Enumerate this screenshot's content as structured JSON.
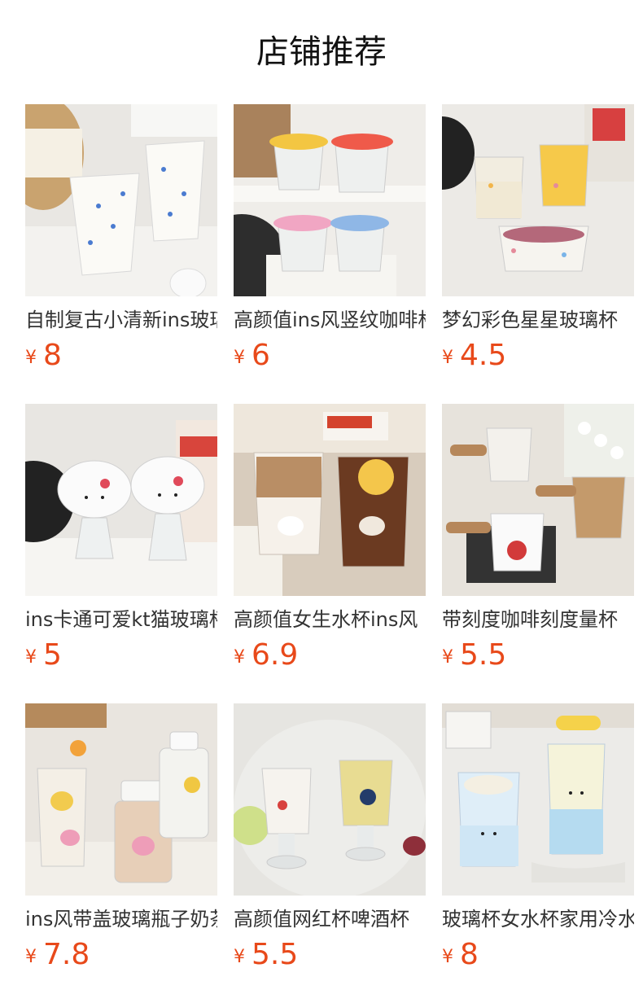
{
  "header": {
    "title": "店铺推荐"
  },
  "colors": {
    "price": "#e8491a"
  },
  "products": [
    {
      "name": "自制复古小清新ins玻璃杯",
      "currency": "¥",
      "price": "8",
      "image": "cups-with-blue-raindrops-photo"
    },
    {
      "name": "高颜值ins风竖纹咖啡杯",
      "currency": "¥",
      "price": "6",
      "image": "lidded-glass-cups-photo"
    },
    {
      "name": "梦幻彩色星星玻璃杯",
      "currency": "¥",
      "price": "4.5",
      "image": "star-print-glassware-photo"
    },
    {
      "name": "ins卡通可爱kt猫玻璃杯",
      "currency": "¥",
      "price": "5",
      "image": "kitty-shaped-glasses-photo"
    },
    {
      "name": "高颜值女生水杯ins风",
      "currency": "¥",
      "price": "6.9",
      "image": "bunny-print-coffee-glasses-photo"
    },
    {
      "name": "带刻度咖啡刻度量杯",
      "currency": "¥",
      "price": "5.5",
      "image": "wooden-handle-measuring-cups-photo"
    },
    {
      "name": "ins风带盖玻璃瓶子奶茶杯",
      "currency": "¥",
      "price": "7.8",
      "image": "bear-print-glass-bottles-photo"
    },
    {
      "name": "高颜值网红杯啤酒杯",
      "currency": "¥",
      "price": "5.5",
      "image": "penguin-beer-glasses-photo"
    },
    {
      "name": "玻璃杯女水杯家用冷水杯",
      "currency": "¥",
      "price": "8",
      "image": "smiley-face-glasses-photo"
    }
  ]
}
